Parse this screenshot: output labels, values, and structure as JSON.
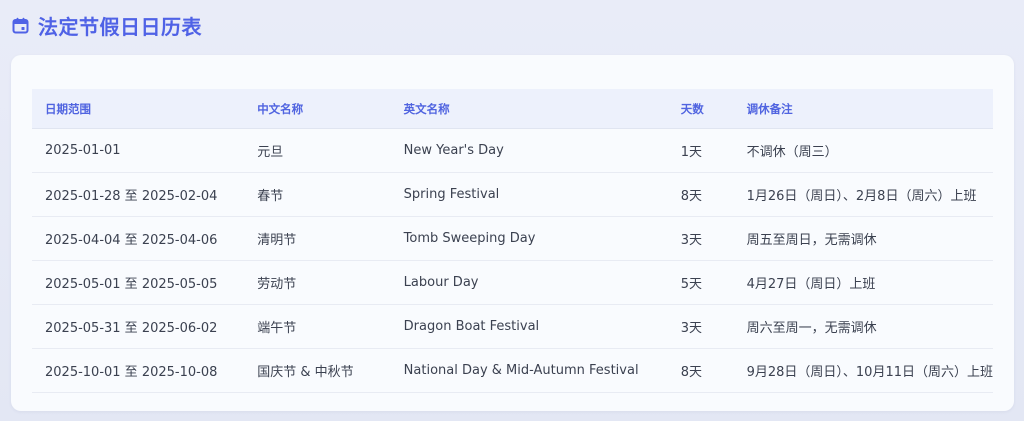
{
  "header": {
    "icon": "calendar-icon",
    "title": "法定节假日日历表",
    "accent_color": "#4f62e6"
  },
  "table": {
    "columns": [
      "日期范围",
      "中文名称",
      "英文名称",
      "天数",
      "调休备注"
    ],
    "rows": [
      {
        "date_range": "2025-01-01",
        "cn_name": "元旦",
        "en_name": "New Year's Day",
        "days": "1天",
        "note": "不调休（周三）"
      },
      {
        "date_range": "2025-01-28 至 2025-02-04",
        "cn_name": "春节",
        "en_name": "Spring Festival",
        "days": "8天",
        "note": "1月26日（周日）、2月8日（周六）上班"
      },
      {
        "date_range": "2025-04-04 至 2025-04-06",
        "cn_name": "清明节",
        "en_name": "Tomb Sweeping Day",
        "days": "3天",
        "note": "周五至周日，无需调休"
      },
      {
        "date_range": "2025-05-01 至 2025-05-05",
        "cn_name": "劳动节",
        "en_name": "Labour Day",
        "days": "5天",
        "note": "4月27日（周日）上班"
      },
      {
        "date_range": "2025-05-31 至 2025-06-02",
        "cn_name": "端午节",
        "en_name": "Dragon Boat Festival",
        "days": "3天",
        "note": "周六至周一，无需调休"
      },
      {
        "date_range": "2025-10-01 至 2025-10-08",
        "cn_name": "国庆节 & 中秋节",
        "en_name": "National Day & Mid-Autumn Festival",
        "days": "8天",
        "note": "9月28日（周日）、10月11日（周六）上班"
      }
    ]
  }
}
